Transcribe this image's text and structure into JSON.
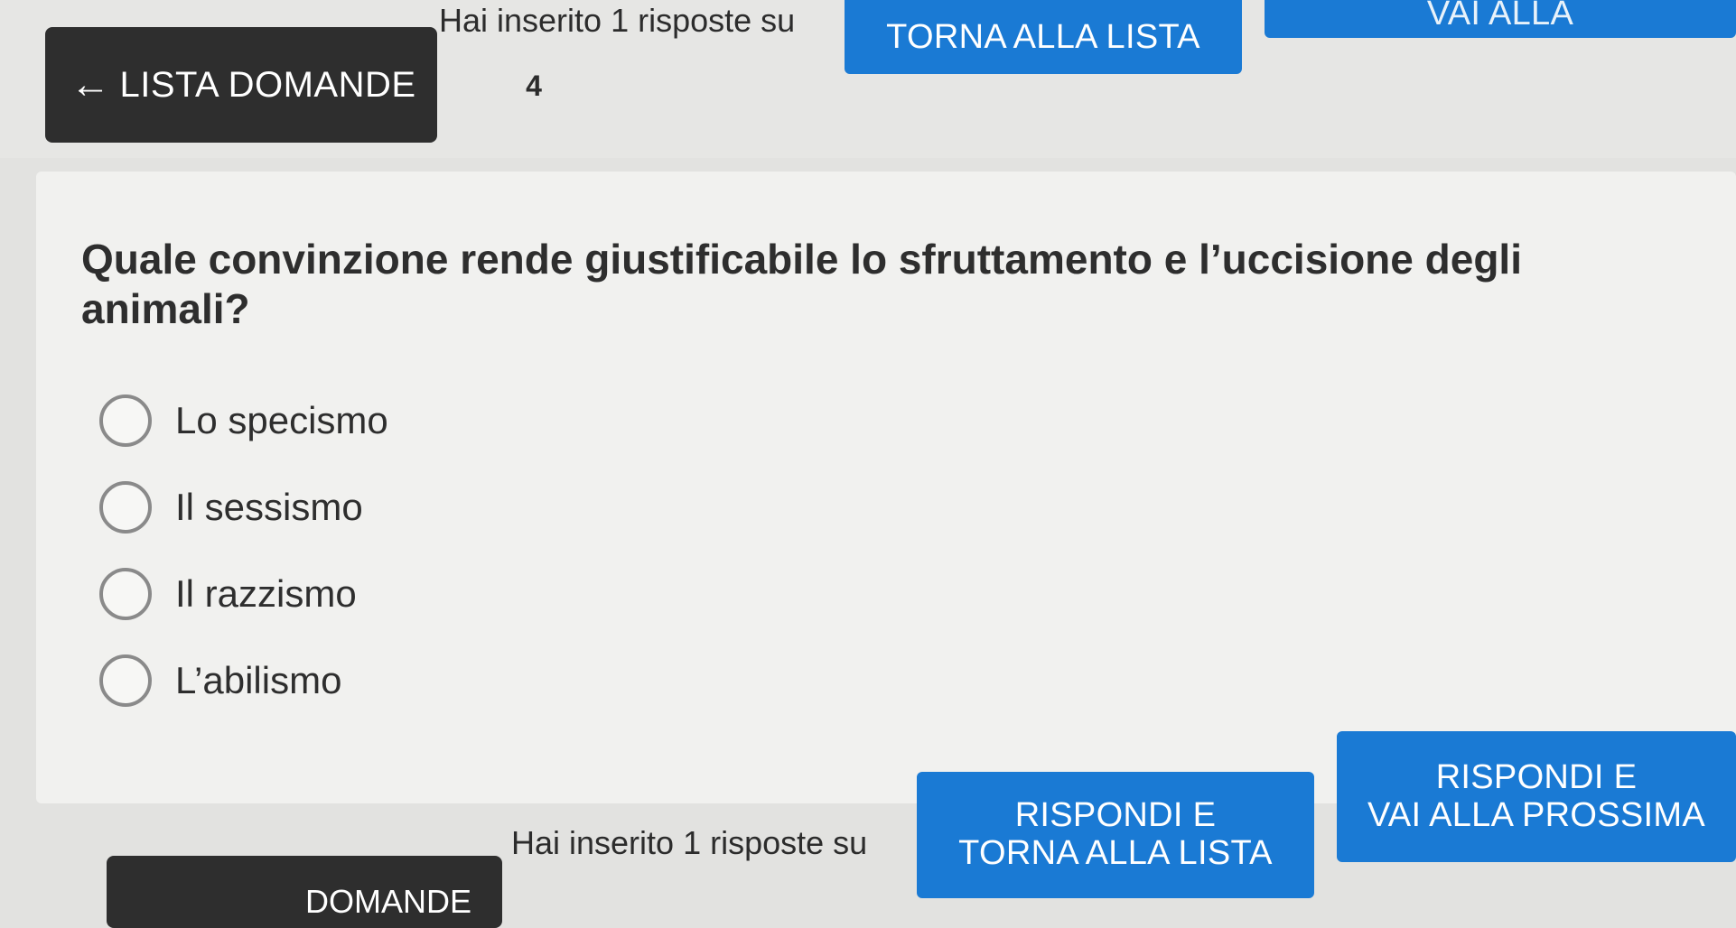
{
  "header": {
    "back_button_label": "LISTA DOMANDE",
    "answered_text": "Hai inserito 1 risposte su",
    "answered_total": "4",
    "return_button_label": "TORNA ALLA LISTA",
    "next_button_partial": "VAI ALLA"
  },
  "question": {
    "text": "Quale convinzione rende giustificabile lo sfruttamento e l’uccisione degli animali?",
    "options": [
      {
        "label": "Lo specismo"
      },
      {
        "label": "Il sessismo"
      },
      {
        "label": "Il razzismo"
      },
      {
        "label": "L’abilismo"
      }
    ]
  },
  "footer": {
    "back_button_partial": "DOMANDE",
    "answered_text": "Hai inserito 1 risposte su",
    "answer_return_line1": "RISPONDI E",
    "answer_return_line2": "TORNA ALLA LISTA",
    "answer_next_line1": "RISPONDI E",
    "answer_next_line2": "VAI ALLA PROSSIMA"
  },
  "colors": {
    "primary_blue": "#1a7ad4",
    "dark_button": "#2e2e2e"
  }
}
